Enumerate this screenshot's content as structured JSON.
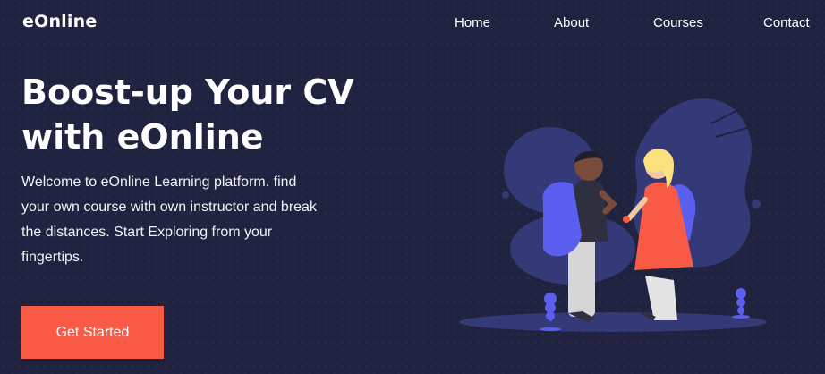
{
  "brand": {
    "logo_text": "eOnline"
  },
  "nav": {
    "items": [
      {
        "label": "Home"
      },
      {
        "label": "About"
      },
      {
        "label": "Courses"
      },
      {
        "label": "Contact"
      }
    ]
  },
  "hero": {
    "title_line1": "Boost-up Your CV",
    "title_line2": "with eOnline",
    "description_line1": "Welcome to eOnline Learning platform. find",
    "description_line2": "your own course with own instructor and break",
    "description_line3": "the distances. Start Exploring from your",
    "description_line4": "fingertips.",
    "cta_label": "Get Started"
  },
  "colors": {
    "background": "#1f2340",
    "accent": "#f95a45",
    "illustration_primary": "#5a5ff0",
    "illustration_shadow": "#343977"
  },
  "illustration": {
    "icon": "students-with-backpacks-illustration"
  }
}
